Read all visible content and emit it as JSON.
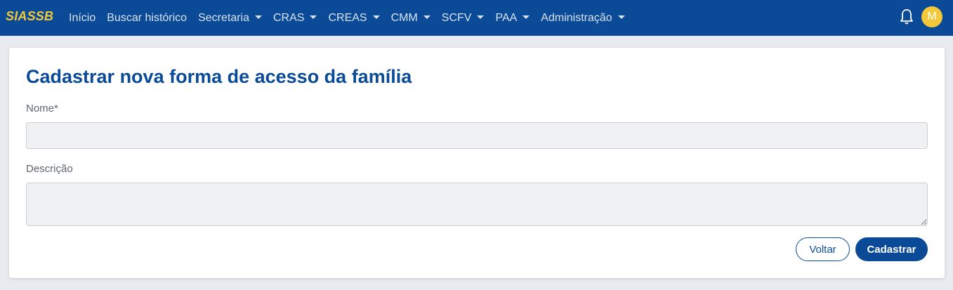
{
  "navbar": {
    "brand": "SIASSB",
    "items": [
      {
        "label": "Início",
        "dropdown": false
      },
      {
        "label": "Buscar histórico",
        "dropdown": false
      },
      {
        "label": "Secretaria",
        "dropdown": true
      },
      {
        "label": "CRAS",
        "dropdown": true
      },
      {
        "label": "CREAS",
        "dropdown": true
      },
      {
        "label": "CMM",
        "dropdown": true
      },
      {
        "label": "SCFV",
        "dropdown": true
      },
      {
        "label": "PAA",
        "dropdown": true
      },
      {
        "label": "Administração",
        "dropdown": true
      }
    ],
    "notifications_icon": "bell-icon",
    "avatar_initial": "M"
  },
  "form": {
    "title": "Cadastrar nova forma de acesso da família",
    "name_label": "Nome*",
    "name_value": "",
    "description_label": "Descrição",
    "description_value": "",
    "back_label": "Voltar",
    "submit_label": "Cadastrar"
  },
  "colors": {
    "primary": "#0b4a96",
    "brand_accent": "#f3c83a",
    "page_background": "#e9ebf0",
    "input_background": "#f0f1f3"
  }
}
